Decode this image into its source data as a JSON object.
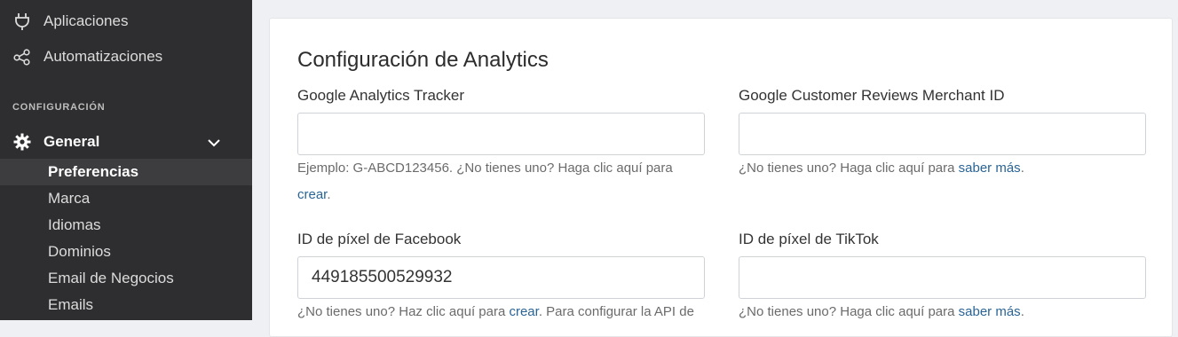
{
  "sidebar": {
    "items": [
      {
        "label": "Aplicaciones",
        "icon": "plug-icon"
      },
      {
        "label": "Automatizaciones",
        "icon": "share-nodes-icon"
      }
    ],
    "section_title": "CONFIGURACIÓN",
    "general": {
      "label": "General",
      "icon": "gear-icon",
      "expanded": true
    },
    "sub_items": [
      {
        "label": "Preferencias",
        "active": true
      },
      {
        "label": "Marca",
        "active": false
      },
      {
        "label": "Idiomas",
        "active": false
      },
      {
        "label": "Dominios",
        "active": false
      },
      {
        "label": "Email de Negocios",
        "active": false
      },
      {
        "label": "Emails",
        "active": false
      }
    ]
  },
  "analytics": {
    "title": "Configuración de Analytics",
    "ga": {
      "label": "Google Analytics Tracker",
      "value": "",
      "help_text": "Ejemplo: G-ABCD123456. ¿No tienes uno? Haga clic aquí para",
      "help_link": "crear",
      "help_end": "."
    },
    "gcr": {
      "label": "Google Customer Reviews Merchant ID",
      "value": "",
      "help_text": "¿No tienes uno? Haga clic aquí para ",
      "help_link": "saber más",
      "help_end": "."
    },
    "fb": {
      "label": "ID de píxel de Facebook",
      "value": "449185500529932",
      "help_text": "¿No tienes uno? Haz clic aquí para ",
      "help_link": "crear",
      "help_end": ". Para configurar la API de"
    },
    "tiktok": {
      "label": "ID de píxel de TikTok",
      "value": "",
      "help_text": "¿No tienes uno? Haga clic aquí para ",
      "help_link": "saber más",
      "help_end": "."
    }
  },
  "colors": {
    "sidebar_bg": "#2e2e30",
    "active_bg": "#3d3d40",
    "link": "#2a6496"
  }
}
